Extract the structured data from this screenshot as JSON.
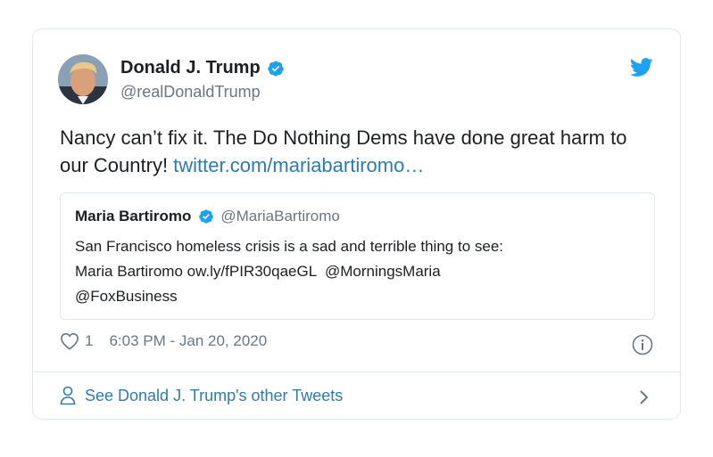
{
  "author": {
    "name": "Donald J. Trump",
    "handle": "@realDonaldTrump",
    "verified": true
  },
  "tweet": {
    "text": "Nancy can’t fix it. The Do Nothing Dems have done great harm to our Country! ",
    "link": "twitter.com/mariabartiromo…"
  },
  "quote": {
    "name": "Maria Bartiromo",
    "handle": "@MariaBartiromo",
    "verified": true,
    "text_line1": "San Francisco homeless crisis is a sad and terrible thing to see:",
    "text_line2": "Maria Bartiromo ow.ly/fPIR30qaeGL  @MorningsMaria",
    "text_line3": "@FoxBusiness"
  },
  "meta": {
    "like_count": "1",
    "timestamp": "6:03 PM - Jan 20, 2020"
  },
  "footer": {
    "label": "See Donald J. Trump's other Tweets"
  },
  "colors": {
    "link": "#2b7bb9",
    "verified": "#1da1f2",
    "secondary_text": "#697882",
    "border": "#e1e8ed"
  },
  "icons": [
    "twitter-bird-icon",
    "verified-badge-icon",
    "heart-icon",
    "info-icon",
    "person-icon",
    "chevron-right-icon"
  ]
}
